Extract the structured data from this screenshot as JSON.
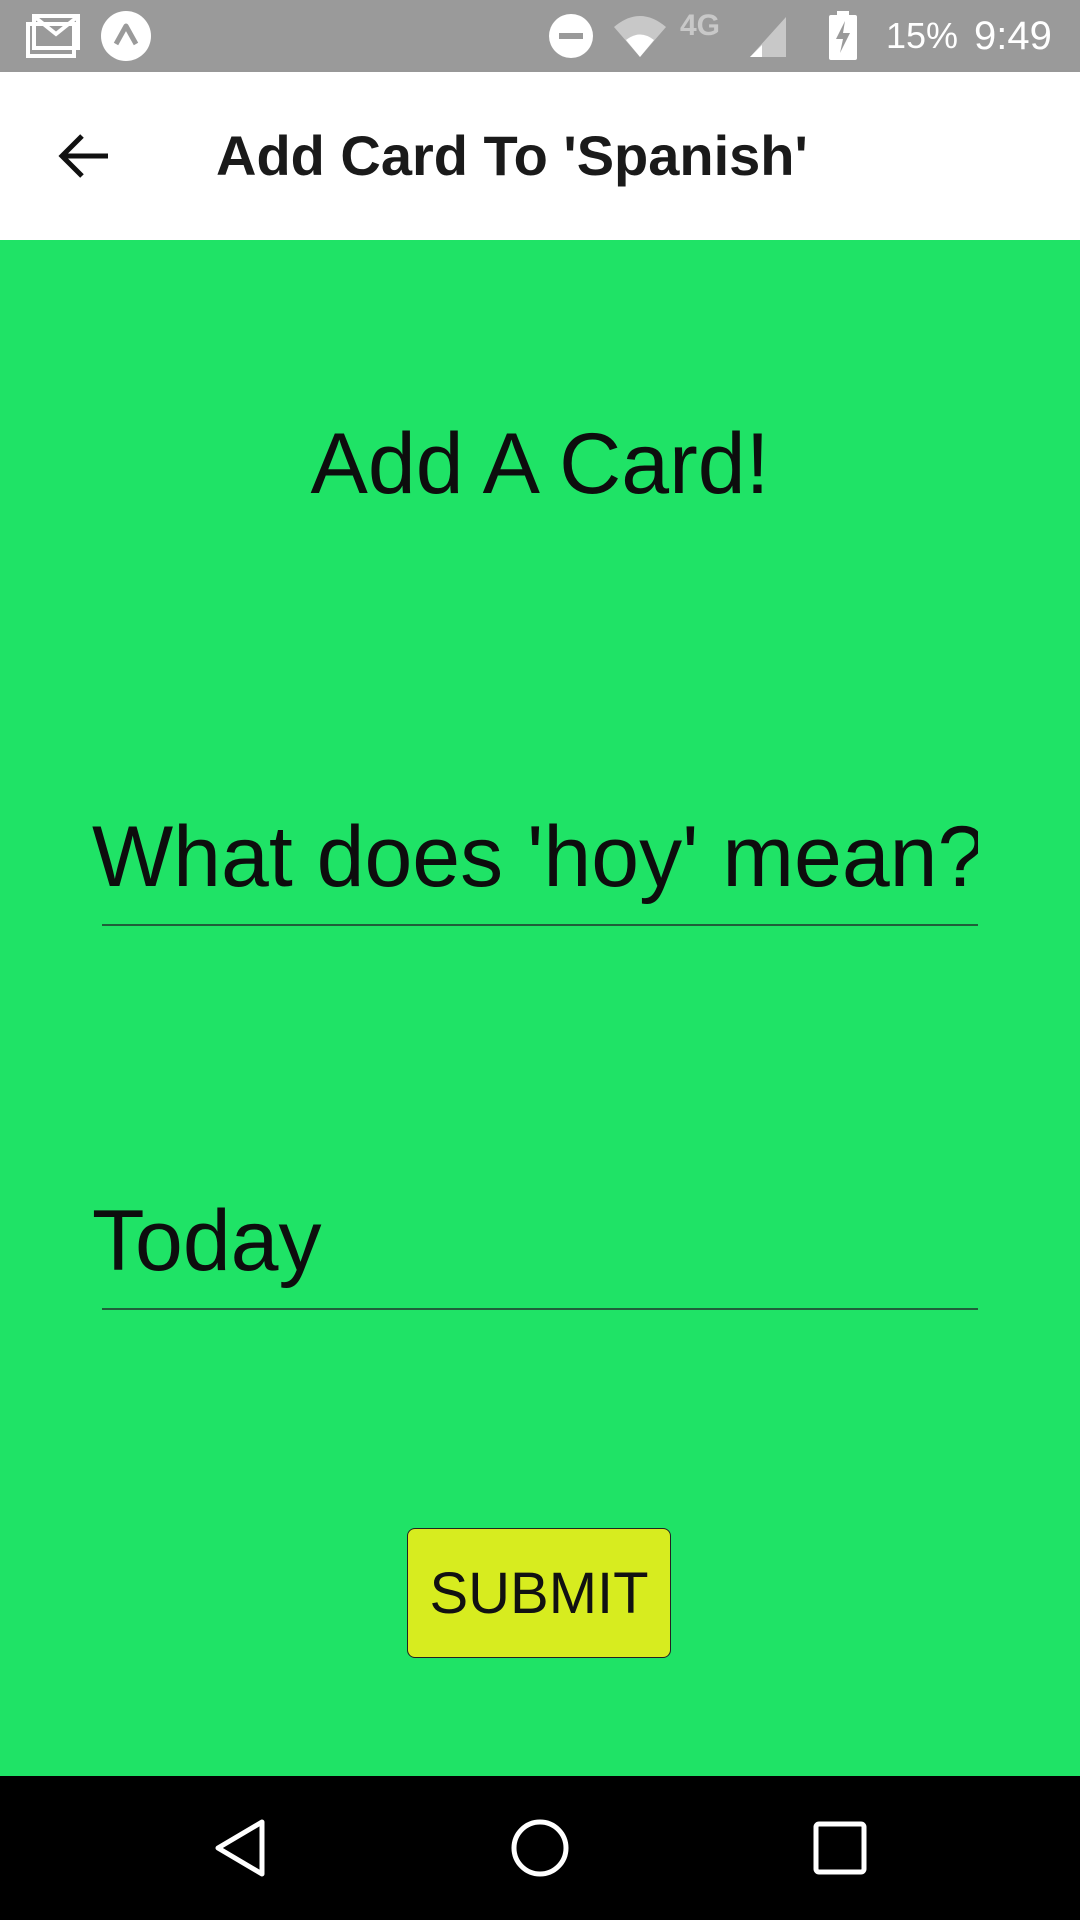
{
  "status_bar": {
    "icons": [
      "gmail-icon",
      "expo-icon",
      "do-not-disturb-icon",
      "wifi-icon",
      "network-4g-lte-icon",
      "signal-icon",
      "battery-charging-icon"
    ],
    "network_label": "4G",
    "battery_percent": "15%",
    "time": "9:49"
  },
  "app_bar": {
    "back_icon": "arrow-left-icon",
    "title": "Add Card To 'Spanish'"
  },
  "main": {
    "heading": "Add A Card!",
    "question_input": {
      "value": "What does 'hoy' mean?"
    },
    "answer_input": {
      "value": "Today"
    },
    "submit_label": "SUBMIT"
  },
  "nav_bar": {
    "icons": [
      "back-triangle-icon",
      "home-circle-icon",
      "recents-square-icon"
    ]
  },
  "colors": {
    "background": "#1fe366",
    "submit_button": "#d7ec1f",
    "status_bar": "#9a9a9a"
  }
}
